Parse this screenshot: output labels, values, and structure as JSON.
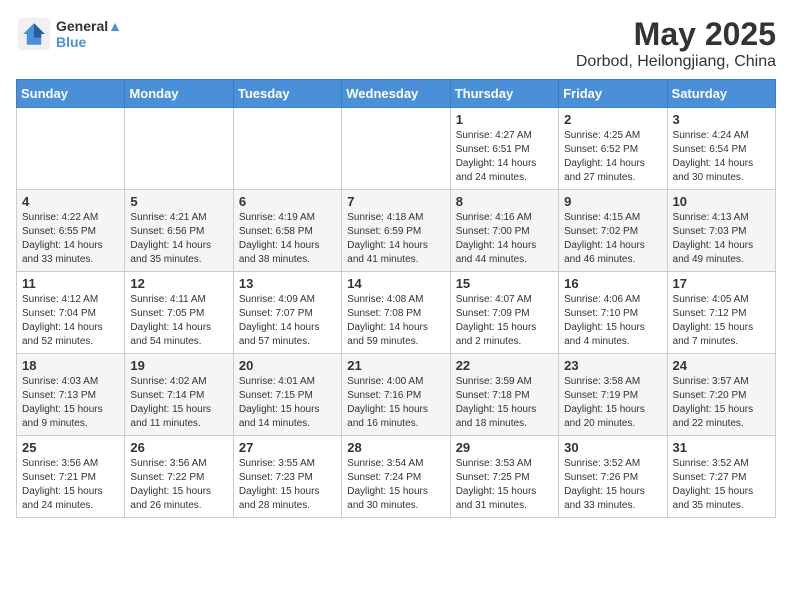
{
  "header": {
    "logo_line1": "General",
    "logo_line2": "Blue",
    "title": "May 2025",
    "subtitle": "Dorbod, Heilongjiang, China"
  },
  "weekdays": [
    "Sunday",
    "Monday",
    "Tuesday",
    "Wednesday",
    "Thursday",
    "Friday",
    "Saturday"
  ],
  "weeks": [
    [
      {
        "day": "",
        "info": ""
      },
      {
        "day": "",
        "info": ""
      },
      {
        "day": "",
        "info": ""
      },
      {
        "day": "",
        "info": ""
      },
      {
        "day": "1",
        "info": "Sunrise: 4:27 AM\nSunset: 6:51 PM\nDaylight: 14 hours\nand 24 minutes."
      },
      {
        "day": "2",
        "info": "Sunrise: 4:25 AM\nSunset: 6:52 PM\nDaylight: 14 hours\nand 27 minutes."
      },
      {
        "day": "3",
        "info": "Sunrise: 4:24 AM\nSunset: 6:54 PM\nDaylight: 14 hours\nand 30 minutes."
      }
    ],
    [
      {
        "day": "4",
        "info": "Sunrise: 4:22 AM\nSunset: 6:55 PM\nDaylight: 14 hours\nand 33 minutes."
      },
      {
        "day": "5",
        "info": "Sunrise: 4:21 AM\nSunset: 6:56 PM\nDaylight: 14 hours\nand 35 minutes."
      },
      {
        "day": "6",
        "info": "Sunrise: 4:19 AM\nSunset: 6:58 PM\nDaylight: 14 hours\nand 38 minutes."
      },
      {
        "day": "7",
        "info": "Sunrise: 4:18 AM\nSunset: 6:59 PM\nDaylight: 14 hours\nand 41 minutes."
      },
      {
        "day": "8",
        "info": "Sunrise: 4:16 AM\nSunset: 7:00 PM\nDaylight: 14 hours\nand 44 minutes."
      },
      {
        "day": "9",
        "info": "Sunrise: 4:15 AM\nSunset: 7:02 PM\nDaylight: 14 hours\nand 46 minutes."
      },
      {
        "day": "10",
        "info": "Sunrise: 4:13 AM\nSunset: 7:03 PM\nDaylight: 14 hours\nand 49 minutes."
      }
    ],
    [
      {
        "day": "11",
        "info": "Sunrise: 4:12 AM\nSunset: 7:04 PM\nDaylight: 14 hours\nand 52 minutes."
      },
      {
        "day": "12",
        "info": "Sunrise: 4:11 AM\nSunset: 7:05 PM\nDaylight: 14 hours\nand 54 minutes."
      },
      {
        "day": "13",
        "info": "Sunrise: 4:09 AM\nSunset: 7:07 PM\nDaylight: 14 hours\nand 57 minutes."
      },
      {
        "day": "14",
        "info": "Sunrise: 4:08 AM\nSunset: 7:08 PM\nDaylight: 14 hours\nand 59 minutes."
      },
      {
        "day": "15",
        "info": "Sunrise: 4:07 AM\nSunset: 7:09 PM\nDaylight: 15 hours\nand 2 minutes."
      },
      {
        "day": "16",
        "info": "Sunrise: 4:06 AM\nSunset: 7:10 PM\nDaylight: 15 hours\nand 4 minutes."
      },
      {
        "day": "17",
        "info": "Sunrise: 4:05 AM\nSunset: 7:12 PM\nDaylight: 15 hours\nand 7 minutes."
      }
    ],
    [
      {
        "day": "18",
        "info": "Sunrise: 4:03 AM\nSunset: 7:13 PM\nDaylight: 15 hours\nand 9 minutes."
      },
      {
        "day": "19",
        "info": "Sunrise: 4:02 AM\nSunset: 7:14 PM\nDaylight: 15 hours\nand 11 minutes."
      },
      {
        "day": "20",
        "info": "Sunrise: 4:01 AM\nSunset: 7:15 PM\nDaylight: 15 hours\nand 14 minutes."
      },
      {
        "day": "21",
        "info": "Sunrise: 4:00 AM\nSunset: 7:16 PM\nDaylight: 15 hours\nand 16 minutes."
      },
      {
        "day": "22",
        "info": "Sunrise: 3:59 AM\nSunset: 7:18 PM\nDaylight: 15 hours\nand 18 minutes."
      },
      {
        "day": "23",
        "info": "Sunrise: 3:58 AM\nSunset: 7:19 PM\nDaylight: 15 hours\nand 20 minutes."
      },
      {
        "day": "24",
        "info": "Sunrise: 3:57 AM\nSunset: 7:20 PM\nDaylight: 15 hours\nand 22 minutes."
      }
    ],
    [
      {
        "day": "25",
        "info": "Sunrise: 3:56 AM\nSunset: 7:21 PM\nDaylight: 15 hours\nand 24 minutes."
      },
      {
        "day": "26",
        "info": "Sunrise: 3:56 AM\nSunset: 7:22 PM\nDaylight: 15 hours\nand 26 minutes."
      },
      {
        "day": "27",
        "info": "Sunrise: 3:55 AM\nSunset: 7:23 PM\nDaylight: 15 hours\nand 28 minutes."
      },
      {
        "day": "28",
        "info": "Sunrise: 3:54 AM\nSunset: 7:24 PM\nDaylight: 15 hours\nand 30 minutes."
      },
      {
        "day": "29",
        "info": "Sunrise: 3:53 AM\nSunset: 7:25 PM\nDaylight: 15 hours\nand 31 minutes."
      },
      {
        "day": "30",
        "info": "Sunrise: 3:52 AM\nSunset: 7:26 PM\nDaylight: 15 hours\nand 33 minutes."
      },
      {
        "day": "31",
        "info": "Sunrise: 3:52 AM\nSunset: 7:27 PM\nDaylight: 15 hours\nand 35 minutes."
      }
    ]
  ]
}
